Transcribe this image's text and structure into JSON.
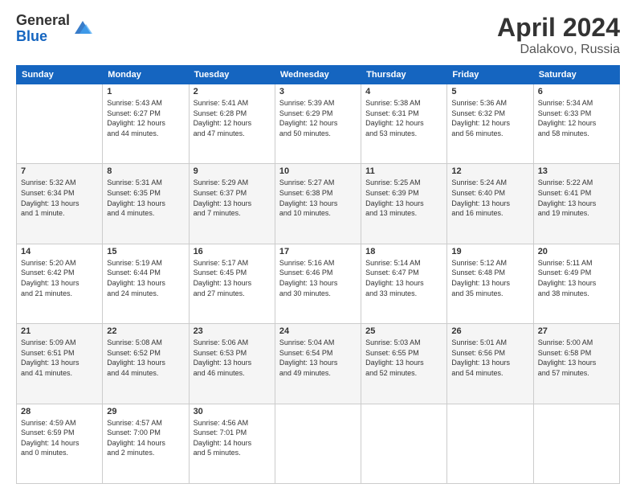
{
  "header": {
    "logo_general": "General",
    "logo_blue": "Blue",
    "month_year": "April 2024",
    "location": "Dalakovo, Russia"
  },
  "calendar": {
    "days_of_week": [
      "Sunday",
      "Monday",
      "Tuesday",
      "Wednesday",
      "Thursday",
      "Friday",
      "Saturday"
    ],
    "weeks": [
      [
        {
          "day": "",
          "info": ""
        },
        {
          "day": "1",
          "info": "Sunrise: 5:43 AM\nSunset: 6:27 PM\nDaylight: 12 hours\nand 44 minutes."
        },
        {
          "day": "2",
          "info": "Sunrise: 5:41 AM\nSunset: 6:28 PM\nDaylight: 12 hours\nand 47 minutes."
        },
        {
          "day": "3",
          "info": "Sunrise: 5:39 AM\nSunset: 6:29 PM\nDaylight: 12 hours\nand 50 minutes."
        },
        {
          "day": "4",
          "info": "Sunrise: 5:38 AM\nSunset: 6:31 PM\nDaylight: 12 hours\nand 53 minutes."
        },
        {
          "day": "5",
          "info": "Sunrise: 5:36 AM\nSunset: 6:32 PM\nDaylight: 12 hours\nand 56 minutes."
        },
        {
          "day": "6",
          "info": "Sunrise: 5:34 AM\nSunset: 6:33 PM\nDaylight: 12 hours\nand 58 minutes."
        }
      ],
      [
        {
          "day": "7",
          "info": "Sunrise: 5:32 AM\nSunset: 6:34 PM\nDaylight: 13 hours\nand 1 minute."
        },
        {
          "day": "8",
          "info": "Sunrise: 5:31 AM\nSunset: 6:35 PM\nDaylight: 13 hours\nand 4 minutes."
        },
        {
          "day": "9",
          "info": "Sunrise: 5:29 AM\nSunset: 6:37 PM\nDaylight: 13 hours\nand 7 minutes."
        },
        {
          "day": "10",
          "info": "Sunrise: 5:27 AM\nSunset: 6:38 PM\nDaylight: 13 hours\nand 10 minutes."
        },
        {
          "day": "11",
          "info": "Sunrise: 5:25 AM\nSunset: 6:39 PM\nDaylight: 13 hours\nand 13 minutes."
        },
        {
          "day": "12",
          "info": "Sunrise: 5:24 AM\nSunset: 6:40 PM\nDaylight: 13 hours\nand 16 minutes."
        },
        {
          "day": "13",
          "info": "Sunrise: 5:22 AM\nSunset: 6:41 PM\nDaylight: 13 hours\nand 19 minutes."
        }
      ],
      [
        {
          "day": "14",
          "info": "Sunrise: 5:20 AM\nSunset: 6:42 PM\nDaylight: 13 hours\nand 21 minutes."
        },
        {
          "day": "15",
          "info": "Sunrise: 5:19 AM\nSunset: 6:44 PM\nDaylight: 13 hours\nand 24 minutes."
        },
        {
          "day": "16",
          "info": "Sunrise: 5:17 AM\nSunset: 6:45 PM\nDaylight: 13 hours\nand 27 minutes."
        },
        {
          "day": "17",
          "info": "Sunrise: 5:16 AM\nSunset: 6:46 PM\nDaylight: 13 hours\nand 30 minutes."
        },
        {
          "day": "18",
          "info": "Sunrise: 5:14 AM\nSunset: 6:47 PM\nDaylight: 13 hours\nand 33 minutes."
        },
        {
          "day": "19",
          "info": "Sunrise: 5:12 AM\nSunset: 6:48 PM\nDaylight: 13 hours\nand 35 minutes."
        },
        {
          "day": "20",
          "info": "Sunrise: 5:11 AM\nSunset: 6:49 PM\nDaylight: 13 hours\nand 38 minutes."
        }
      ],
      [
        {
          "day": "21",
          "info": "Sunrise: 5:09 AM\nSunset: 6:51 PM\nDaylight: 13 hours\nand 41 minutes."
        },
        {
          "day": "22",
          "info": "Sunrise: 5:08 AM\nSunset: 6:52 PM\nDaylight: 13 hours\nand 44 minutes."
        },
        {
          "day": "23",
          "info": "Sunrise: 5:06 AM\nSunset: 6:53 PM\nDaylight: 13 hours\nand 46 minutes."
        },
        {
          "day": "24",
          "info": "Sunrise: 5:04 AM\nSunset: 6:54 PM\nDaylight: 13 hours\nand 49 minutes."
        },
        {
          "day": "25",
          "info": "Sunrise: 5:03 AM\nSunset: 6:55 PM\nDaylight: 13 hours\nand 52 minutes."
        },
        {
          "day": "26",
          "info": "Sunrise: 5:01 AM\nSunset: 6:56 PM\nDaylight: 13 hours\nand 54 minutes."
        },
        {
          "day": "27",
          "info": "Sunrise: 5:00 AM\nSunset: 6:58 PM\nDaylight: 13 hours\nand 57 minutes."
        }
      ],
      [
        {
          "day": "28",
          "info": "Sunrise: 4:59 AM\nSunset: 6:59 PM\nDaylight: 14 hours\nand 0 minutes."
        },
        {
          "day": "29",
          "info": "Sunrise: 4:57 AM\nSunset: 7:00 PM\nDaylight: 14 hours\nand 2 minutes."
        },
        {
          "day": "30",
          "info": "Sunrise: 4:56 AM\nSunset: 7:01 PM\nDaylight: 14 hours\nand 5 minutes."
        },
        {
          "day": "",
          "info": ""
        },
        {
          "day": "",
          "info": ""
        },
        {
          "day": "",
          "info": ""
        },
        {
          "day": "",
          "info": ""
        }
      ]
    ]
  }
}
